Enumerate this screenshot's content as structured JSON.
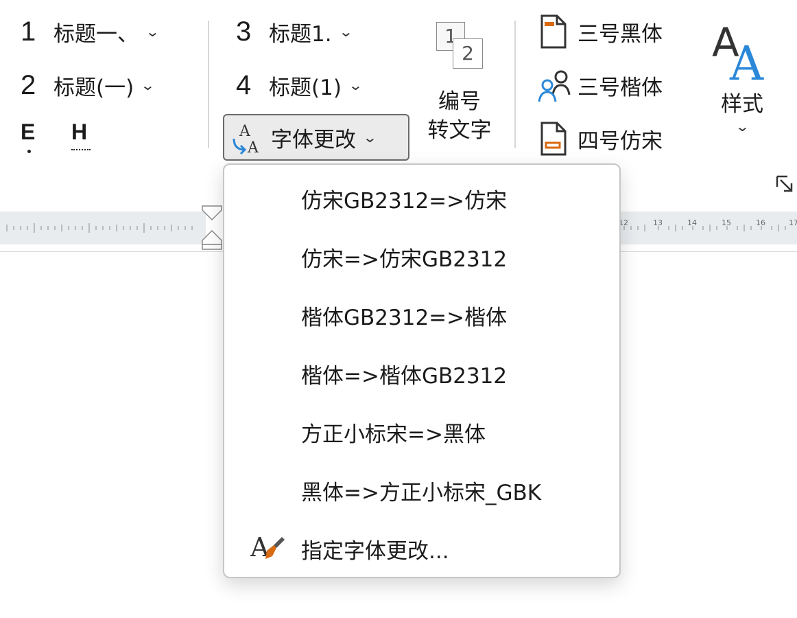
{
  "heading_gallery": {
    "h1": {
      "num": "1",
      "label": "标题一、"
    },
    "h2": {
      "num": "2",
      "label": "标题(一)"
    },
    "h3": {
      "num": "3",
      "label": "标题1."
    },
    "h4": {
      "num": "4",
      "label": "标题(1)"
    },
    "mark_e": "E",
    "mark_h": "H"
  },
  "font_change_button": {
    "label": "字体更改",
    "icon": "font-swap-icon"
  },
  "number_to_text_button": {
    "line1": "编号",
    "line2": "转文字",
    "icon_digits": [
      "1",
      "2"
    ]
  },
  "style_presets": [
    {
      "label": "三号黑体",
      "icon": "document-orange-top-icon"
    },
    {
      "label": "三号楷体",
      "icon": "people-icon"
    },
    {
      "label": "四号仿宋",
      "icon": "document-orange-bottom-icon"
    }
  ],
  "styles_button": {
    "label": "样式",
    "icon": "big-A-styles-icon"
  },
  "dialog_launcher_icon": "dialog-launcher-icon",
  "ruler": {
    "right_labels": [
      "12",
      "13",
      "14",
      "15",
      "16",
      "17"
    ]
  },
  "font_change_menu": {
    "items": [
      {
        "label": "仿宋GB2312=>仿宋"
      },
      {
        "label": "仿宋=>仿宋GB2312"
      },
      {
        "label": "楷体GB2312=>楷体"
      },
      {
        "label": "楷体=>楷体GB2312"
      },
      {
        "label": "方正小标宋=>黑体"
      },
      {
        "label": "黑体=>方正小标宋_GBK"
      },
      {
        "label": "指定字体更改...",
        "icon": "font-brush-icon"
      }
    ]
  },
  "colors": {
    "accent_blue": "#2b88d8",
    "accent_orange": "#d86a12",
    "button_pressed_bg": "#ebebeb",
    "ruler_bg": "#e8ecef"
  }
}
